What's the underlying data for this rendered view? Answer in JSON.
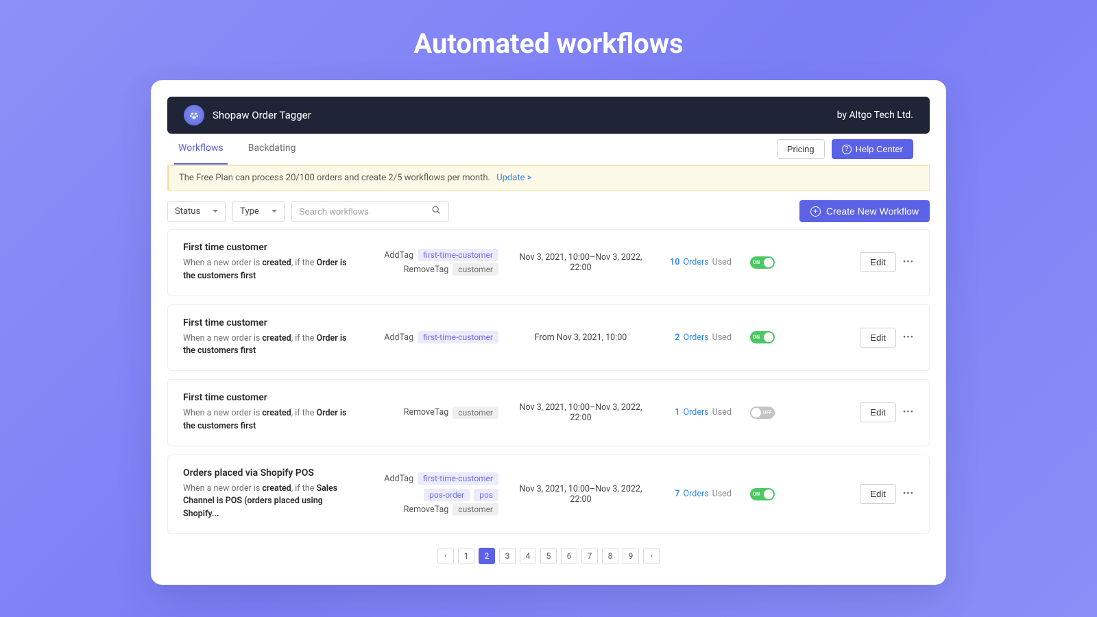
{
  "hero_title": "Automated workflows",
  "header": {
    "app_name": "Shopaw Order Tagger",
    "by": "by Altgo Tech Ltd."
  },
  "tabs": {
    "workflows": "Workflows",
    "backdating": "Backdating",
    "pricing": "Pricing",
    "help_center": "Help Center"
  },
  "banner": {
    "text": "The Free Plan can process 20/100 orders and create 2/5 workflows per month.",
    "link": "Update >"
  },
  "filters": {
    "status": "Status",
    "type": "Type",
    "search_placeholder": "Search workflows"
  },
  "create_btn": "Create New Workflow",
  "tag_actions": {
    "add": "AddTag",
    "remove": "RemoveTag"
  },
  "usage_labels": {
    "orders": "Orders",
    "used": "Used"
  },
  "toggle_labels": {
    "on": "ON",
    "off": "OFF"
  },
  "edit_label": "Edit",
  "workflows": [
    {
      "title": "First time customer",
      "desc_pre": "When a new order is ",
      "desc_b1": "created",
      "desc_mid": ", if the ",
      "desc_b2": "Order is the customers first",
      "add_tags": [
        "first-time-customer"
      ],
      "remove_tags": [
        "customer"
      ],
      "date": "Nov 3, 2021, 10:00–Nov 3, 2022, 22:00",
      "count": "10",
      "toggle": "on"
    },
    {
      "title": "First time customer",
      "desc_pre": "When a new order is ",
      "desc_b1": "created",
      "desc_mid": ", if the ",
      "desc_b2": "Order is the customers first",
      "add_tags": [
        "first-time-customer"
      ],
      "remove_tags": [],
      "date": "From Nov 3, 2021, 10:00",
      "count": "2",
      "toggle": "on"
    },
    {
      "title": "First time customer",
      "desc_pre": "When a new order is ",
      "desc_b1": "created",
      "desc_mid": ", if the ",
      "desc_b2": "Order is the customers first",
      "add_tags": [],
      "remove_tags": [
        "customer"
      ],
      "date": "Nov 3, 2021, 10:00–Nov 3, 2022, 22:00",
      "count": "1",
      "toggle": "off"
    },
    {
      "title": "Orders placed via Shopify POS",
      "desc_pre": "When a new order is ",
      "desc_b1": "created",
      "desc_mid": ", if the ",
      "desc_b2": "Sales Channel is POS (orders placed using Shopify...",
      "add_tags": [
        "first-time-customer",
        "pos-order",
        "pos"
      ],
      "remove_tags": [
        "customer"
      ],
      "date": "Nov 3, 2021, 10:00–Nov 3, 2022, 22:00",
      "count": "7",
      "toggle": "on"
    }
  ],
  "pagination": {
    "pages": [
      "1",
      "2",
      "3",
      "4",
      "5",
      "6",
      "7",
      "8",
      "9"
    ],
    "active": "2"
  }
}
